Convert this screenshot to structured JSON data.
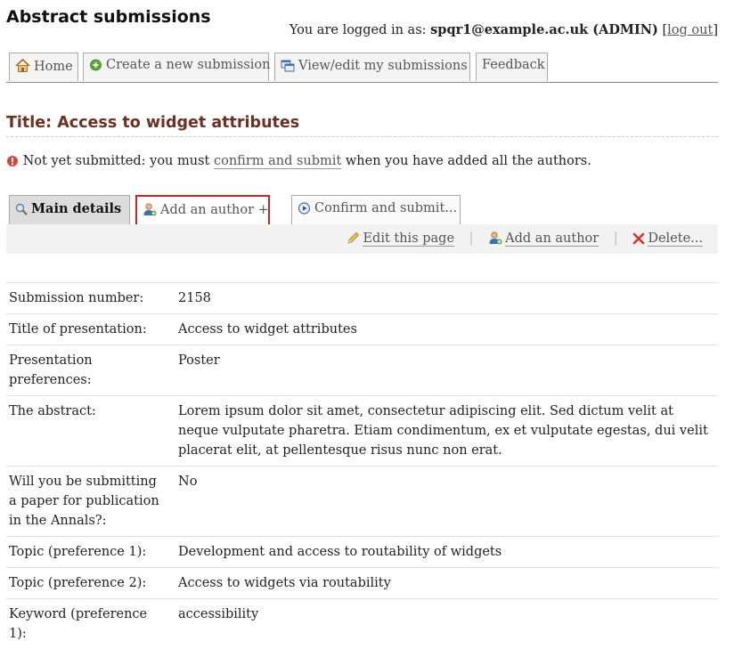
{
  "app": {
    "title": "Abstract submissions",
    "login_prefix": "You are logged in as:",
    "login_user": "spqr1@example.ac.uk (ADMIN)",
    "logout_open": "[",
    "logout_label": "log out",
    "logout_close": "]"
  },
  "nav": {
    "tabs": [
      {
        "label": "Home",
        "icon": "home-icon"
      },
      {
        "label": "Create a new submission",
        "icon": "add-circle-icon"
      },
      {
        "label": "View/edit my submissions",
        "icon": "windows-icon"
      },
      {
        "label": "Feedback",
        "icon": ""
      }
    ]
  },
  "page": {
    "title": "Title: Access to widget attributes",
    "status_prefix": "Not yet submitted: you must",
    "status_link": "confirm and submit",
    "status_suffix": "when you have added all the authors."
  },
  "subtabs": [
    {
      "label": "Main details",
      "icon": "magnifier-icon"
    },
    {
      "label": "Add an author +",
      "icon": "user-add-icon"
    },
    {
      "label": "Confirm and submit...",
      "icon": "play-circle-icon"
    }
  ],
  "actions": {
    "edit": "Edit this page",
    "add_author": "Add an author",
    "delete": "Delete..."
  },
  "details": [
    {
      "label": "Submission number:",
      "value": "2158"
    },
    {
      "label": "Title of presentation:",
      "value": "Access to widget attributes"
    },
    {
      "label": "Presentation preferences:",
      "value": "Poster"
    },
    {
      "label": "The abstract:",
      "value": "Lorem ipsum dolor sit amet, consectetur adipiscing elit. Sed dictum velit at neque vulputate pharetra. Etiam condimentum, ex et vulputate egestas, dui velit placerat elit, at pellentesque risus nunc non erat."
    },
    {
      "label": "Will you be submitting a paper for publication in the Annals?:",
      "value": "No"
    },
    {
      "label": "Topic (preference 1):",
      "value": "Development and access to routability of widgets"
    },
    {
      "label": "Topic (preference 2):",
      "value": "Access to widgets via routability"
    },
    {
      "label": "Keyword (preference 1):",
      "value": "accessibility"
    }
  ],
  "colors": {
    "title": "#6b3223",
    "active_tab": "#dcdcdc",
    "add_tab_border": "#c0282d",
    "warning": "#d9453a"
  }
}
